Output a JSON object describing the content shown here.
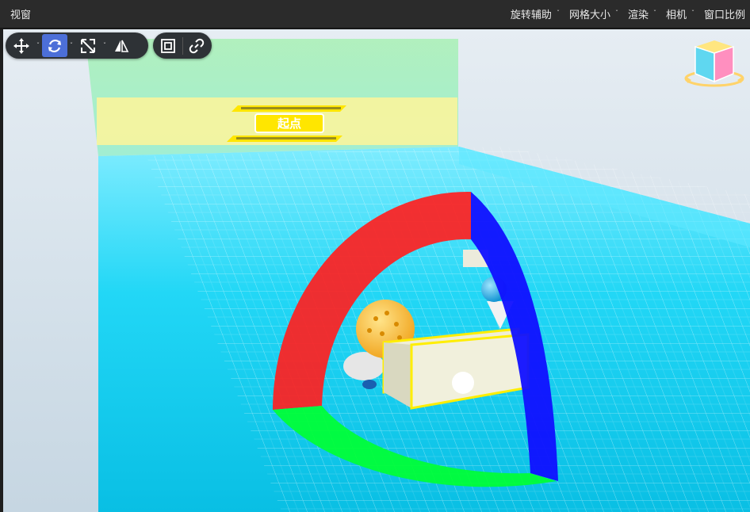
{
  "window": {
    "title": "视窗"
  },
  "menus": [
    {
      "label": "旋转辅助"
    },
    {
      "label": "网格大小"
    },
    {
      "label": "渲染"
    },
    {
      "label": "相机"
    },
    {
      "label": "窗口比例"
    }
  ],
  "toolbar": {
    "tools": [
      {
        "name": "move-tool",
        "icon": "move-icon",
        "active": false
      },
      {
        "name": "rotate-tool",
        "icon": "rotate-icon",
        "active": true
      },
      {
        "name": "scale-tool",
        "icon": "scale-icon",
        "active": false
      },
      {
        "name": "mirror-tool",
        "icon": "mirror-icon",
        "active": false
      },
      {
        "name": "focus-tool",
        "icon": "focus-icon",
        "active": false
      },
      {
        "name": "link-tool",
        "icon": "link-icon",
        "active": false
      }
    ]
  },
  "scene": {
    "banner_text": "起点",
    "gizmo_colors": {
      "x": "#ff2020",
      "y": "#00ff33",
      "z": "#1010ff"
    },
    "floor_color": "#00d8f0",
    "selection_color": "#ffee00"
  },
  "view_cube": {
    "icon": "view-cube-icon"
  }
}
